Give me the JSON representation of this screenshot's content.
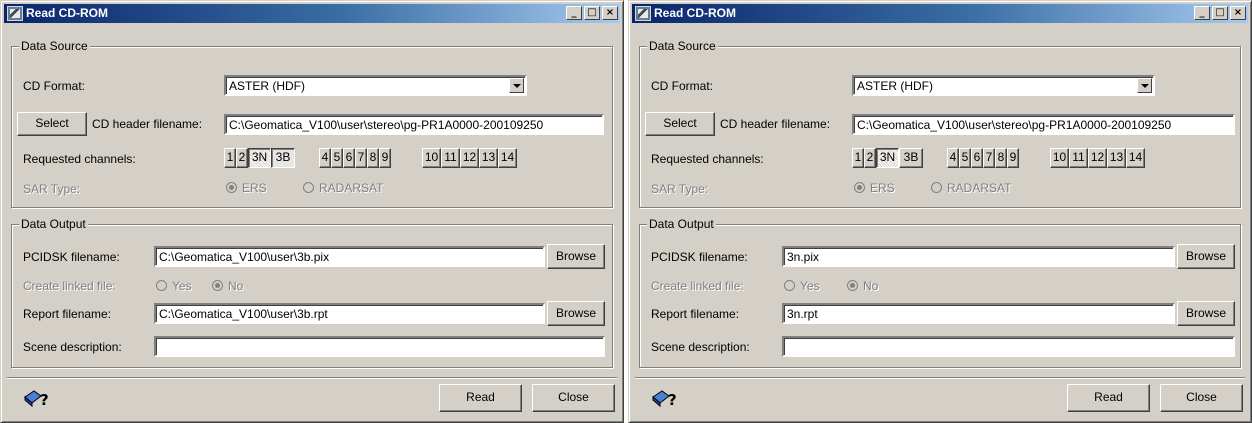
{
  "windows": [
    {
      "title": "Read CD-ROM",
      "data_source": {
        "group_label": "Data Source",
        "cd_format_label": "CD Format:",
        "cd_format_value": "ASTER (HDF)",
        "select_button": "Select",
        "cd_header_label": "CD header filename:",
        "cd_header_value": "C:\\Geomatica_V100\\user\\stereo\\pg-PR1A0000-200109250",
        "requested_channels_label": "Requested channels:",
        "channels": [
          {
            "label": "1",
            "selected": false
          },
          {
            "label": "2",
            "selected": false
          },
          {
            "label": "3N",
            "selected": true,
            "pattern": true
          },
          {
            "label": "3B",
            "selected": true,
            "pattern": false
          },
          {
            "label": "4",
            "selected": false
          },
          {
            "label": "5",
            "selected": false
          },
          {
            "label": "6",
            "selected": false
          },
          {
            "label": "7",
            "selected": false
          },
          {
            "label": "8",
            "selected": false
          },
          {
            "label": "9",
            "selected": false
          },
          {
            "label": "10",
            "selected": false
          },
          {
            "label": "11",
            "selected": false
          },
          {
            "label": "12",
            "selected": false
          },
          {
            "label": "13",
            "selected": false
          },
          {
            "label": "14",
            "selected": false
          }
        ],
        "sar_type_label": "SAR Type:",
        "sar_options": [
          "ERS",
          "RADARSAT"
        ],
        "sar_selected": "ERS"
      },
      "data_output": {
        "group_label": "Data Output",
        "pcidsk_label": "PCIDSK filename:",
        "pcidsk_value": "C:\\Geomatica_V100\\user\\3b.pix",
        "browse_label": "Browse",
        "linked_label": "Create linked file:",
        "linked_options": [
          "Yes",
          "No"
        ],
        "linked_selected": "No",
        "report_label": "Report filename:",
        "report_value": "C:\\Geomatica_V100\\user\\3b.rpt",
        "scene_label": "Scene description:",
        "scene_value": ""
      },
      "footer": {
        "read_label": "Read",
        "close_label": "Close",
        "help_icon": "help-book-icon"
      }
    },
    {
      "title": "Read CD-ROM",
      "data_source": {
        "group_label": "Data Source",
        "cd_format_label": "CD Format:",
        "cd_format_value": "ASTER (HDF)",
        "select_button": "Select",
        "cd_header_label": "CD header filename:",
        "cd_header_value": "C:\\Geomatica_V100\\user\\stereo\\pg-PR1A0000-200109250",
        "requested_channels_label": "Requested channels:",
        "channels": [
          {
            "label": "1",
            "selected": false
          },
          {
            "label": "2",
            "selected": false
          },
          {
            "label": "3N",
            "selected": true,
            "pattern": true
          },
          {
            "label": "3B",
            "selected": false
          },
          {
            "label": "4",
            "selected": false
          },
          {
            "label": "5",
            "selected": false
          },
          {
            "label": "6",
            "selected": false
          },
          {
            "label": "7",
            "selected": false
          },
          {
            "label": "8",
            "selected": false
          },
          {
            "label": "9",
            "selected": false
          },
          {
            "label": "10",
            "selected": false
          },
          {
            "label": "11",
            "selected": false
          },
          {
            "label": "12",
            "selected": false
          },
          {
            "label": "13",
            "selected": false
          },
          {
            "label": "14",
            "selected": false
          }
        ],
        "sar_type_label": "SAR Type:",
        "sar_options": [
          "ERS",
          "RADARSAT"
        ],
        "sar_selected": "ERS"
      },
      "data_output": {
        "group_label": "Data Output",
        "pcidsk_label": "PCIDSK filename:",
        "pcidsk_value": "3n.pix",
        "browse_label": "Browse",
        "linked_label": "Create linked file:",
        "linked_options": [
          "Yes",
          "No"
        ],
        "linked_selected": "No",
        "report_label": "Report filename:",
        "report_value": "3n.rpt",
        "scene_label": "Scene description:",
        "scene_value": ""
      },
      "footer": {
        "read_label": "Read",
        "close_label": "Close",
        "help_icon": "help-book-icon"
      }
    }
  ]
}
